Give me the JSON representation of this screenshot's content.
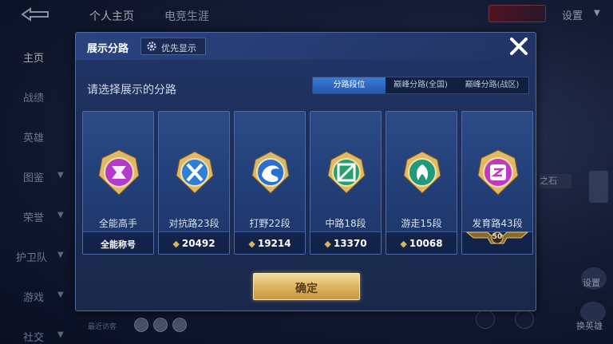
{
  "top_tabs": [
    "个人主页",
    "电竞生涯"
  ],
  "settings_label": "设置",
  "side_menu": [
    {
      "label": "主页",
      "active": true,
      "has_arrow": false
    },
    {
      "label": "战绩",
      "active": false,
      "has_arrow": false
    },
    {
      "label": "英雄",
      "active": false,
      "has_arrow": false
    },
    {
      "label": "图鉴",
      "active": false,
      "has_arrow": true
    },
    {
      "label": "荣誉",
      "active": false,
      "has_arrow": true
    },
    {
      "label": "护卫队",
      "active": false,
      "has_arrow": true
    },
    {
      "label": "游戏",
      "active": false,
      "has_arrow": true
    },
    {
      "label": "社交",
      "active": false,
      "has_arrow": true
    }
  ],
  "right_panel": {
    "stone_label": "之石",
    "button1_label": "设置",
    "button2_label": "换英雄"
  },
  "recent_visitors_label": "最近访客",
  "modal": {
    "title": "展示分路",
    "priority_button": "优先显示",
    "subtitle": "请选择展示的分路",
    "tabs": [
      "分路段位",
      "巅峰分路(全国)",
      "巅峰分路(战区)"
    ],
    "active_tab": 0,
    "confirm_label": "确定",
    "cards": [
      {
        "lane": "全能高手",
        "bottom_type": "title",
        "bottom_text": "全能称号",
        "color": "#b43ac9",
        "icon": "all-round-icon"
      },
      {
        "lane": "对抗路23段",
        "bottom_type": "score",
        "bottom_text": "20492",
        "color": "#2f7fd8",
        "icon": "clash-lane-icon"
      },
      {
        "lane": "打野22段",
        "bottom_type": "score",
        "bottom_text": "19214",
        "color": "#2b6fd1",
        "icon": "jungle-dragon-icon"
      },
      {
        "lane": "中路18段",
        "bottom_type": "score",
        "bottom_text": "13370",
        "color": "#23a06c",
        "icon": "mid-lane-icon"
      },
      {
        "lane": "游走15段",
        "bottom_type": "score",
        "bottom_text": "10068",
        "color": "#1f9a7a",
        "icon": "roam-icon"
      },
      {
        "lane": "发育路43段",
        "bottom_type": "stars",
        "bottom_text": "50",
        "color": "#c23ac4",
        "icon": "farm-lane-icon"
      }
    ]
  },
  "colors": {
    "accent_blue": "#3a7ad8",
    "gold": "#e0b866",
    "panel": "#223566"
  }
}
